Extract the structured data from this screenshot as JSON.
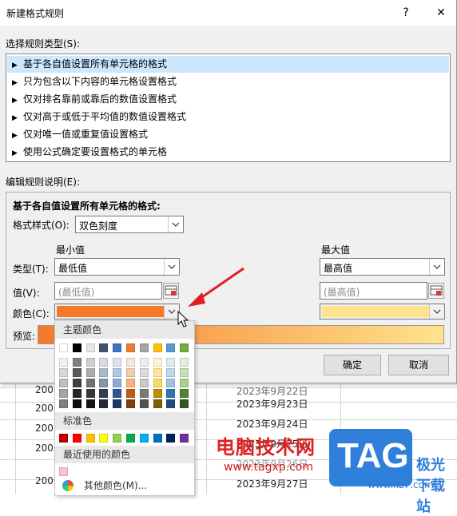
{
  "dialog": {
    "title": "新建格式规则",
    "help_label": "?",
    "close_label": "✕"
  },
  "rule_type": {
    "label": "选择规则类型(S):",
    "items": [
      "基于各自值设置所有单元格的格式",
      "只为包含以下内容的单元格设置格式",
      "仅对排名靠前或靠后的数值设置格式",
      "仅对高于或低于平均值的数值设置格式",
      "仅对唯一值或重复值设置格式",
      "使用公式确定要设置格式的单元格"
    ],
    "selected_index": 0
  },
  "edit": {
    "label": "编辑规则说明(E):",
    "heading": "基于各自值设置所有单元格的格式:",
    "format_style_label": "格式样式(O):",
    "format_style_value": "双色刻度",
    "min_header": "最小值",
    "max_header": "最大值",
    "type_label": "类型(T):",
    "value_label": "值(V):",
    "color_label": "颜色(C):",
    "preview_label": "预览:",
    "min_type": "最低值",
    "max_type": "最高值",
    "min_value_placeholder": "(最低值)",
    "max_value_placeholder": "(最高值)",
    "min_color": "#f4792b",
    "max_color": "#ffe38c"
  },
  "buttons": {
    "ok": "确定",
    "cancel": "取消"
  },
  "palette": {
    "theme_header": "主题颜色",
    "standard_header": "标准色",
    "recent_header": "最近使用的颜色",
    "more_label": "其他颜色(M)...",
    "theme_top": [
      "#ffffff",
      "#000000",
      "#e7e6e6",
      "#44546a",
      "#4472c4",
      "#ed7d31",
      "#a5a5a5",
      "#ffc000",
      "#5b9bd5",
      "#70ad47"
    ],
    "theme_shades": [
      [
        "#f2f2f2",
        "#7f7f7f",
        "#d0cece",
        "#d6dce4",
        "#d9e2f3",
        "#fbe5d5",
        "#ededed",
        "#fff2cc",
        "#deebf6",
        "#e2efd9"
      ],
      [
        "#d8d8d8",
        "#595959",
        "#aeabab",
        "#adb9ca",
        "#b4c6e7",
        "#f7cbac",
        "#dbdbdb",
        "#fee599",
        "#bdd7ee",
        "#c5e0b3"
      ],
      [
        "#bfbfbf",
        "#3f3f3f",
        "#757070",
        "#8496b0",
        "#8eaadb",
        "#f4b183",
        "#c9c9c9",
        "#ffd965",
        "#9cc3e5",
        "#a8d08d"
      ],
      [
        "#a5a5a5",
        "#262626",
        "#3a3838",
        "#323f4f",
        "#2f5496",
        "#c55a11",
        "#7b7b7b",
        "#bf9000",
        "#2e75b5",
        "#538135"
      ],
      [
        "#7f7f7f",
        "#0c0c0c",
        "#171616",
        "#222a35",
        "#1f3864",
        "#833c0b",
        "#525252",
        "#7f6000",
        "#1e4e79",
        "#375623"
      ]
    ],
    "standard": [
      "#c00000",
      "#ff0000",
      "#ffc000",
      "#ffff00",
      "#92d050",
      "#00b050",
      "#00b0f0",
      "#0070c0",
      "#002060",
      "#7030a0"
    ],
    "recent": [
      "#f9c0e0"
    ]
  },
  "sheet": {
    "col_a": [
      "200",
      "200",
      "200",
      "200",
      "200"
    ],
    "dates": [
      "2023年9月22日",
      "2023年9月23日",
      "2023年9月24日",
      "2023年9月25日",
      "2023年9月26日",
      "2023年9月27日"
    ]
  },
  "watermark": {
    "cn": "电脑技术网",
    "url": "www.tagxp.com",
    "tag": "TAG",
    "site": "极光下载站",
    "site_url": "www.xz7.com"
  }
}
